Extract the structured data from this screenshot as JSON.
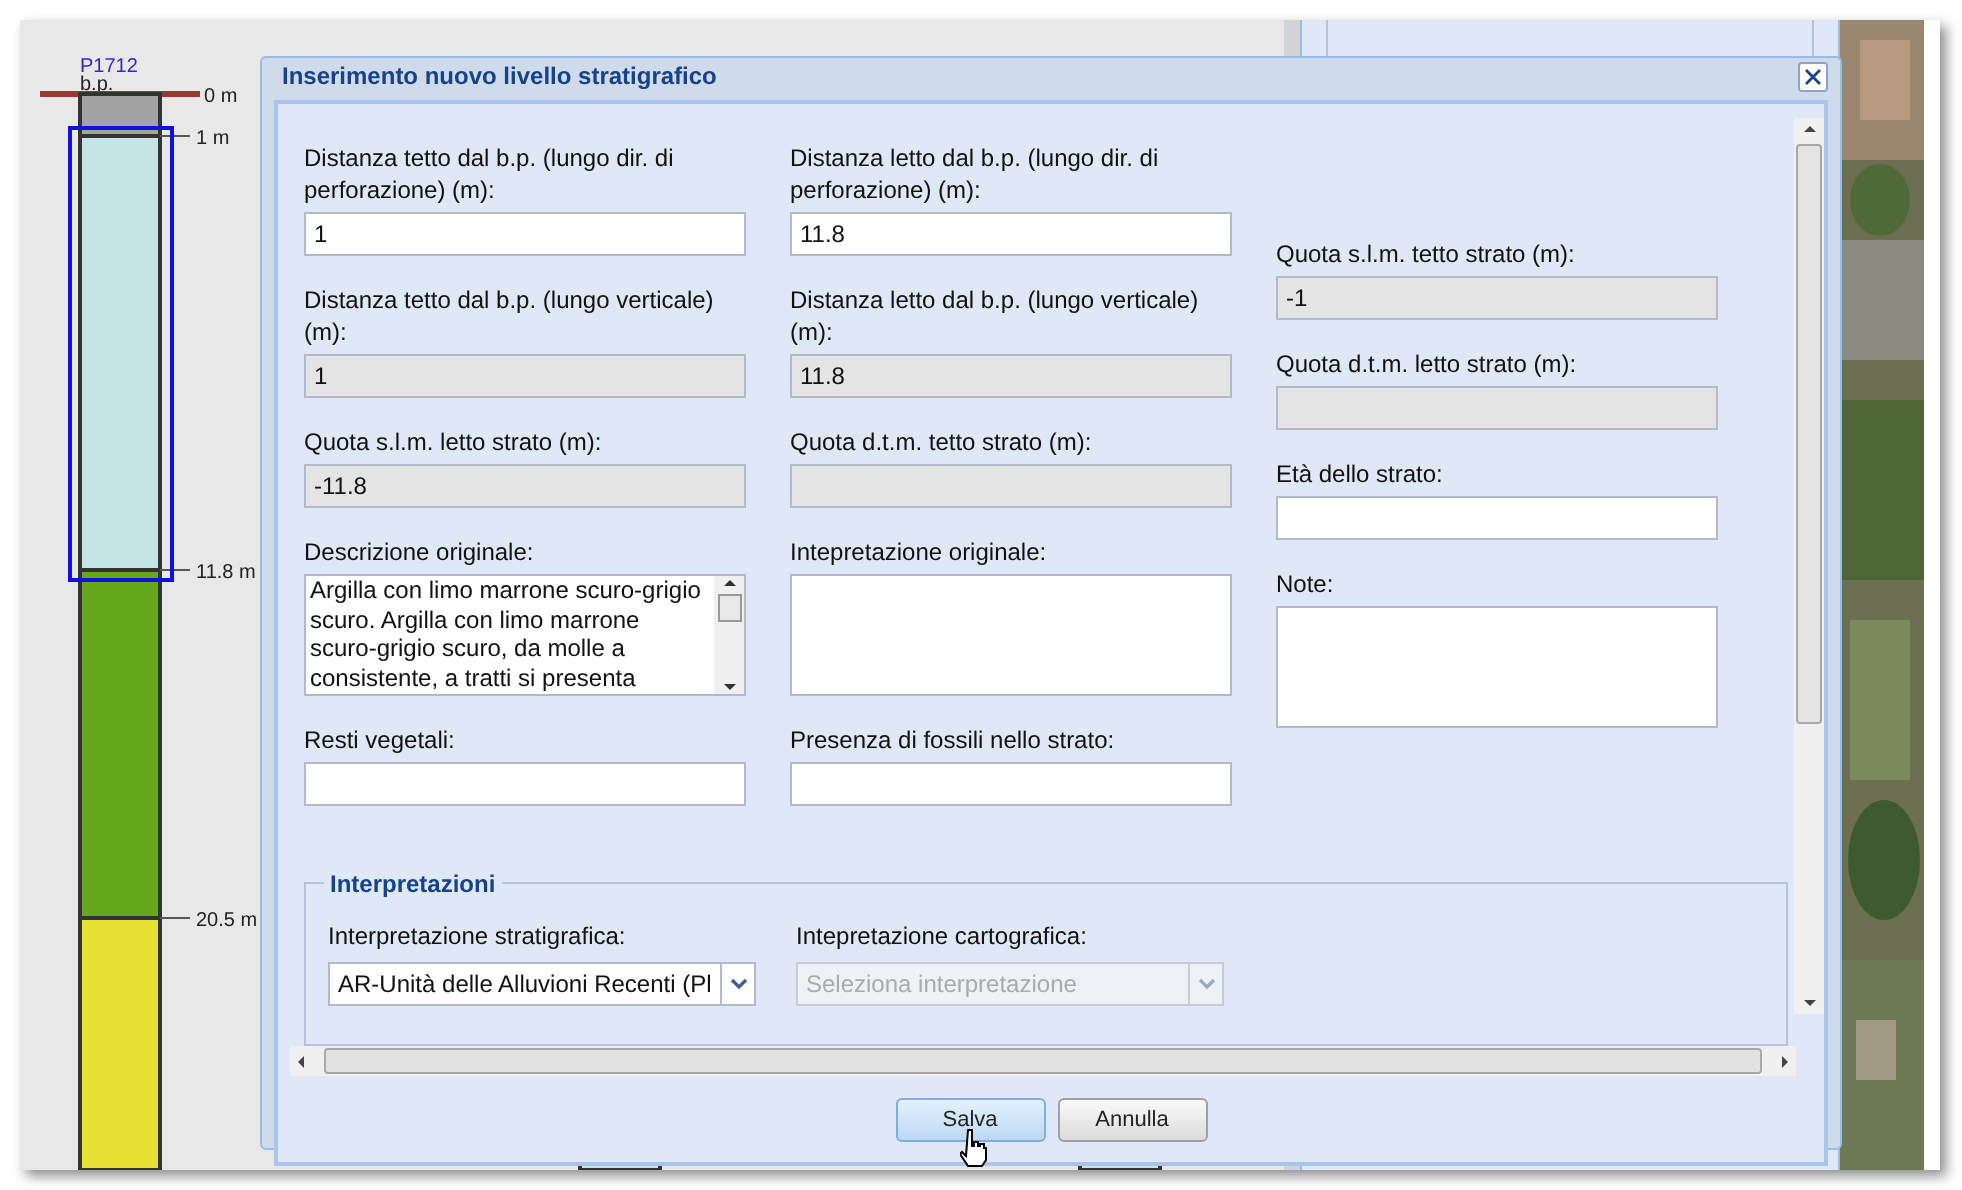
{
  "strata_log": {
    "title": "P1712",
    "datum": "b.p.",
    "layers": [
      {
        "top_label": "0 m",
        "color": "#a3a3a3",
        "selected": false
      },
      {
        "top_label": "1 m",
        "color": "#c5e4e4",
        "selected": true
      },
      {
        "top_label": "11.8 m",
        "color": "#66a81c",
        "selected": false
      },
      {
        "top_label": "20.5 m",
        "color": "#e5e234",
        "selected": false
      }
    ]
  },
  "dialog": {
    "title": "Inserimento nuovo livello stratigrafico",
    "columns": [
      [
        {
          "kind": "input",
          "label": "Distanza tetto dal b.p. (lungo dir. di perforazione) (m):",
          "value": "1"
        },
        {
          "kind": "readonly",
          "label": "Distanza tetto dal b.p. (lungo verticale) (m):",
          "value": "1"
        },
        {
          "kind": "readonly",
          "label": "Quota s.l.m. letto strato (m):",
          "value": "-11.8"
        },
        {
          "kind": "textarea",
          "label": "Descrizione originale:",
          "value": "Argilla con limo marrone scuro-grigio scuro. Argilla con limo marrone scuro-grigio scuro, da molle a consistente, a tratti si presenta"
        },
        {
          "kind": "input",
          "label": "Resti vegetali:"
        }
      ],
      [
        {
          "kind": "input",
          "label": "Distanza letto dal b.p. (lungo dir. di perforazione) (m):",
          "value": "11.8"
        },
        {
          "kind": "readonly",
          "label": "Distanza letto dal b.p. (lungo verticale) (m):",
          "value": "11.8"
        },
        {
          "kind": "readonly",
          "label": "Quota d.t.m. tetto strato (m):"
        },
        {
          "kind": "textarea",
          "label": "Intepretazione originale:"
        },
        {
          "kind": "input",
          "label": "Presenza di fossili nello strato:"
        }
      ],
      [
        {
          "kind": "readonly",
          "label": "Quota s.l.m. tetto strato (m):",
          "value": "-1"
        },
        {
          "kind": "readonly",
          "label": "Quota d.t.m. letto strato (m):"
        },
        {
          "kind": "input",
          "label": "Età dello strato:"
        },
        {
          "kind": "textarea",
          "label": "Note:"
        }
      ]
    ],
    "fieldset": {
      "legend": "Interpretazioni",
      "combos": [
        {
          "label": "Interpretazione stratigrafica:",
          "value": "AR-Unità delle Alluvioni Recenti (Pl",
          "disabled": false
        },
        {
          "label": "Intepretazione cartografica:",
          "placeholder": "Seleziona interpretazione",
          "disabled": true
        }
      ]
    },
    "buttons": [
      {
        "label": "Salva",
        "hovered": true
      },
      {
        "label": "Annulla",
        "hovered": false
      }
    ]
  }
}
